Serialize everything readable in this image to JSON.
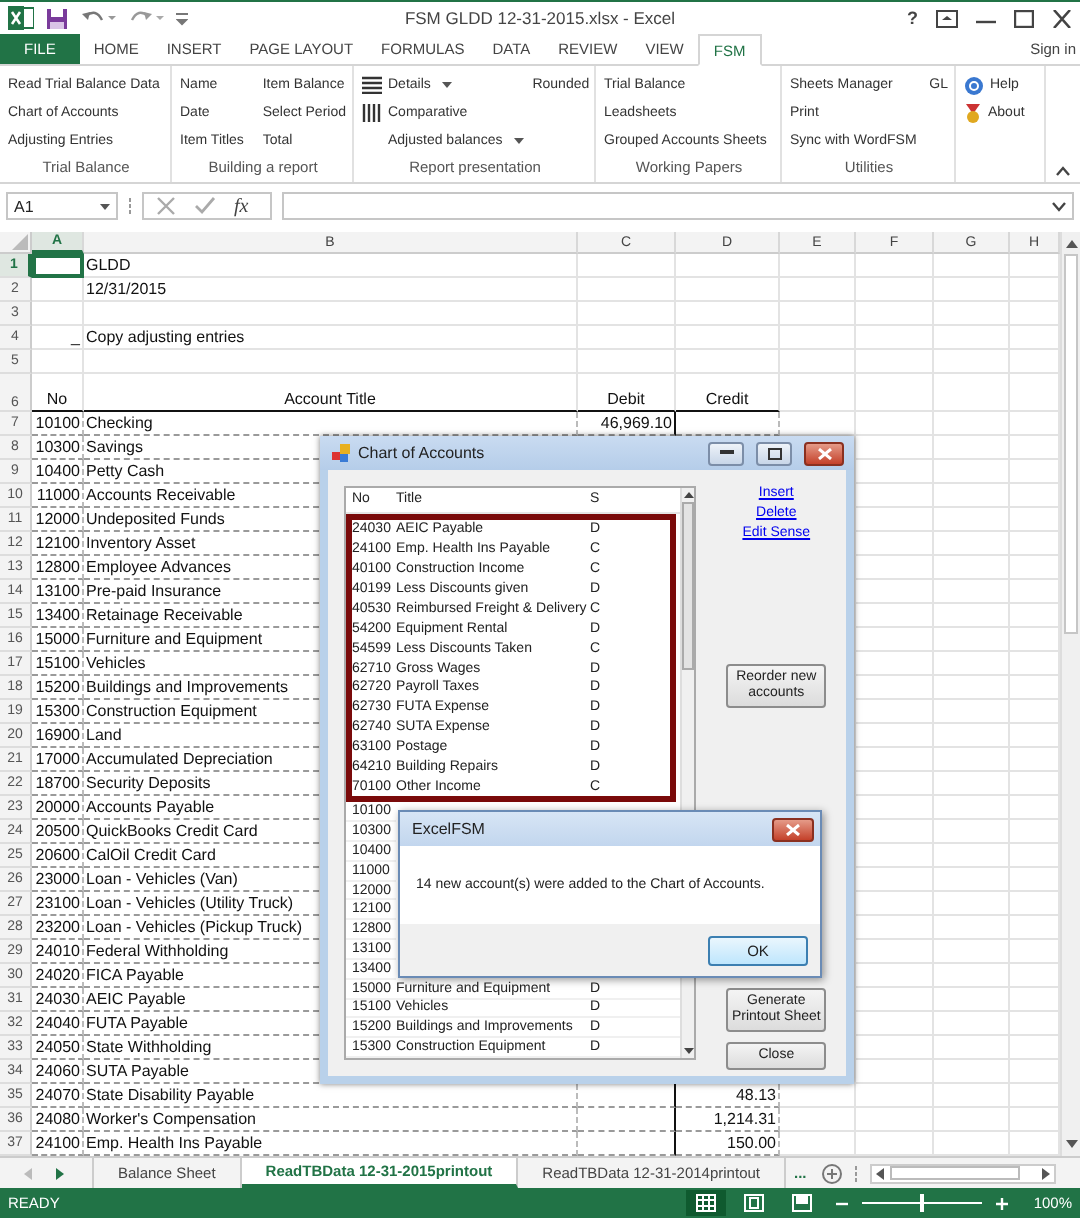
{
  "window": {
    "title": "FSM GLDD 12-31-2015.xlsx - Excel",
    "help_button": "?"
  },
  "ribbon_tabs": [
    {
      "label": "FILE",
      "kind": "file",
      "selected": false
    },
    {
      "label": "HOME",
      "kind": "tab",
      "selected": false
    },
    {
      "label": "INSERT",
      "kind": "tab",
      "selected": false
    },
    {
      "label": "PAGE LAYOUT",
      "kind": "tab",
      "selected": false
    },
    {
      "label": "FORMULAS",
      "kind": "tab",
      "selected": false
    },
    {
      "label": "DATA",
      "kind": "tab",
      "selected": false
    },
    {
      "label": "REVIEW",
      "kind": "tab",
      "selected": false
    },
    {
      "label": "VIEW",
      "kind": "tab",
      "selected": false
    },
    {
      "label": "FSM",
      "kind": "tab",
      "selected": true
    }
  ],
  "sign_in": "Sign in",
  "ribbon_groups": [
    {
      "label": "Trial Balance",
      "columns": [
        [
          {
            "label": "Read Trial Balance Data"
          },
          {
            "label": "Chart of Accounts"
          },
          {
            "label": "Adjusting Entries"
          }
        ]
      ]
    },
    {
      "label": "Building a report",
      "columns": [
        [
          {
            "label": "Name"
          },
          {
            "label": "Date"
          },
          {
            "label": "Item Titles"
          }
        ],
        [
          {
            "label": "Item Balance"
          },
          {
            "label": "Select Period"
          },
          {
            "label": "Total"
          }
        ]
      ]
    },
    {
      "label": "Report presentation",
      "columns": [
        [
          {
            "label": "Details",
            "dropdown": true
          },
          {
            "label": "Comparative"
          },
          {
            "label": "Adjusted balances",
            "dropdown": true
          }
        ],
        [
          {
            "label": "Rounded"
          }
        ]
      ]
    },
    {
      "label": "Working Papers",
      "columns": [
        [
          {
            "label": "Trial Balance"
          },
          {
            "label": "Leadsheets"
          },
          {
            "label": "Grouped Accounts Sheets"
          }
        ]
      ]
    },
    {
      "label": "Utilities",
      "columns": [
        [
          {
            "label": "Sheets Manager"
          },
          {
            "label": "Print"
          },
          {
            "label": "Sync with WordFSM"
          }
        ],
        [
          {
            "label": "GL"
          }
        ]
      ]
    },
    {
      "columns": [
        [
          {
            "label": "Help"
          },
          {
            "label": "About"
          }
        ]
      ]
    }
  ],
  "formula_bar": {
    "name_box": "A1",
    "function_button": "fx"
  },
  "sheet": {
    "columns": [
      {
        "label": "A",
        "selected": true
      },
      {
        "label": "B",
        "selected": false
      },
      {
        "label": "C",
        "selected": false
      },
      {
        "label": "D",
        "selected": false
      },
      {
        "label": "E",
        "selected": false
      },
      {
        "label": "F",
        "selected": false
      },
      {
        "label": "G",
        "selected": false
      },
      {
        "label": "H",
        "selected": false
      }
    ],
    "rows": [
      {
        "num": "1",
        "kind": "plain",
        "selected": true,
        "b": "GLDD"
      },
      {
        "num": "2",
        "kind": "plain",
        "selected": false,
        "b": "12/31/2015"
      },
      {
        "num": "3",
        "kind": "plain",
        "selected": false
      },
      {
        "num": "4",
        "kind": "plain",
        "selected": false,
        "a": "_",
        "b": "Copy adjusting entries"
      },
      {
        "num": "5",
        "kind": "plain",
        "selected": false
      },
      {
        "num": "6",
        "kind": "header",
        "selected": false,
        "a": "No",
        "b": "Account Title",
        "c": "Debit",
        "d": "Credit"
      },
      {
        "num": "7",
        "kind": "account",
        "selected": false,
        "a": "10100",
        "b": "Checking",
        "c": "46,969.10"
      },
      {
        "num": "8",
        "kind": "account",
        "selected": false,
        "a": "10300",
        "b": "Savings"
      },
      {
        "num": "9",
        "kind": "account",
        "selected": false,
        "a": "10400",
        "b": "Petty Cash"
      },
      {
        "num": "10",
        "kind": "account",
        "selected": false,
        "a": "11000",
        "b": "Accounts Receivable"
      },
      {
        "num": "11",
        "kind": "account",
        "selected": false,
        "a": "12000",
        "b": "Undeposited Funds"
      },
      {
        "num": "12",
        "kind": "account",
        "selected": false,
        "a": "12100",
        "b": "Inventory Asset"
      },
      {
        "num": "13",
        "kind": "account",
        "selected": false,
        "a": "12800",
        "b": "Employee Advances"
      },
      {
        "num": "14",
        "kind": "account",
        "selected": false,
        "a": "13100",
        "b": "Pre-paid Insurance"
      },
      {
        "num": "15",
        "kind": "account",
        "selected": false,
        "a": "13400",
        "b": "Retainage Receivable"
      },
      {
        "num": "16",
        "kind": "account",
        "selected": false,
        "a": "15000",
        "b": "Furniture and Equipment"
      },
      {
        "num": "17",
        "kind": "account",
        "selected": false,
        "a": "15100",
        "b": "Vehicles"
      },
      {
        "num": "18",
        "kind": "account",
        "selected": false,
        "a": "15200",
        "b": "Buildings and Improvements"
      },
      {
        "num": "19",
        "kind": "account",
        "selected": false,
        "a": "15300",
        "b": "Construction Equipment"
      },
      {
        "num": "20",
        "kind": "account",
        "selected": false,
        "a": "16900",
        "b": "Land"
      },
      {
        "num": "21",
        "kind": "account",
        "selected": false,
        "a": "17000",
        "b": "Accumulated Depreciation"
      },
      {
        "num": "22",
        "kind": "account",
        "selected": false,
        "a": "18700",
        "b": "Security Deposits"
      },
      {
        "num": "23",
        "kind": "account",
        "selected": false,
        "a": "20000",
        "b": "Accounts Payable"
      },
      {
        "num": "24",
        "kind": "account",
        "selected": false,
        "a": "20500",
        "b": "QuickBooks Credit Card"
      },
      {
        "num": "25",
        "kind": "account",
        "selected": false,
        "a": "20600",
        "b": "CalOil Credit Card"
      },
      {
        "num": "26",
        "kind": "account",
        "selected": false,
        "a": "23000",
        "b": "Loan - Vehicles (Van)"
      },
      {
        "num": "27",
        "kind": "account",
        "selected": false,
        "a": "23100",
        "b": "Loan - Vehicles (Utility Truck)"
      },
      {
        "num": "28",
        "kind": "account",
        "selected": false,
        "a": "23200",
        "b": "Loan - Vehicles (Pickup Truck)"
      },
      {
        "num": "29",
        "kind": "account",
        "selected": false,
        "a": "24010",
        "b": "Federal Withholding"
      },
      {
        "num": "30",
        "kind": "account",
        "selected": false,
        "a": "24020",
        "b": "FICA Payable"
      },
      {
        "num": "31",
        "kind": "account",
        "selected": false,
        "a": "24030",
        "b": "AEIC Payable"
      },
      {
        "num": "32",
        "kind": "account",
        "selected": false,
        "a": "24040",
        "b": "FUTA Payable"
      },
      {
        "num": "33",
        "kind": "account",
        "selected": false,
        "a": "24050",
        "b": "State Withholding"
      },
      {
        "num": "34",
        "kind": "account",
        "selected": false,
        "a": "24060",
        "b": "SUTA Payable"
      },
      {
        "num": "35",
        "kind": "account",
        "selected": false,
        "a": "24070",
        "b": "State Disability Payable",
        "d": "48.13"
      },
      {
        "num": "36",
        "kind": "account",
        "selected": false,
        "a": "24080",
        "b": "Worker's Compensation",
        "d": "1,214.31"
      },
      {
        "num": "37",
        "kind": "account",
        "selected": false,
        "a": "24100",
        "b": "Emp. Health Ins Payable",
        "d": "150.00"
      }
    ]
  },
  "sheet_tabs": {
    "tabs": [
      {
        "label": "Balance Sheet",
        "selected": false
      },
      {
        "label": "ReadTBData 12-31-2015printout",
        "selected": true
      },
      {
        "label": "ReadTBData 12-31-2014printout",
        "selected": false
      }
    ],
    "more": "..."
  },
  "status_bar": {
    "status": "READY",
    "zoom": {
      "level": 0.5,
      "reading": "100%"
    }
  },
  "chart_of_accounts": {
    "title": "Chart of Accounts",
    "columns": [
      "No",
      "Title",
      "S"
    ],
    "rows": [
      {
        "no": "24030",
        "title": "AEIC Payable",
        "s": "D",
        "highlighted": true
      },
      {
        "no": "24100",
        "title": "Emp. Health Ins Payable",
        "s": "C",
        "highlighted": true
      },
      {
        "no": "40100",
        "title": "Construction Income",
        "s": "C",
        "highlighted": true
      },
      {
        "no": "40199",
        "title": "Less Discounts given",
        "s": "D",
        "highlighted": true
      },
      {
        "no": "40530",
        "title": "Reimbursed Freight & Delivery",
        "s": "C",
        "highlighted": true
      },
      {
        "no": "54200",
        "title": "Equipment Rental",
        "s": "D",
        "highlighted": true
      },
      {
        "no": "54599",
        "title": "Less Discounts Taken",
        "s": "C",
        "highlighted": true
      },
      {
        "no": "62710",
        "title": "Gross Wages",
        "s": "D",
        "highlighted": true
      },
      {
        "no": "62720",
        "title": "Payroll Taxes",
        "s": "D",
        "highlighted": true
      },
      {
        "no": "62730",
        "title": "FUTA Expense",
        "s": "D",
        "highlighted": true
      },
      {
        "no": "62740",
        "title": "SUTA Expense",
        "s": "D",
        "highlighted": true
      },
      {
        "no": "63100",
        "title": "Postage",
        "s": "D",
        "highlighted": true
      },
      {
        "no": "64210",
        "title": "Building Repairs",
        "s": "D",
        "highlighted": true
      },
      {
        "no": "70100",
        "title": "Other Income",
        "s": "C",
        "highlighted": true
      },
      {
        "no": "10100",
        "highlighted": false
      },
      {
        "no": "10300",
        "highlighted": false
      },
      {
        "no": "10400",
        "highlighted": false
      },
      {
        "no": "11000",
        "highlighted": false
      },
      {
        "no": "12000",
        "highlighted": false
      },
      {
        "no": "12100",
        "highlighted": false
      },
      {
        "no": "12800",
        "highlighted": false
      },
      {
        "no": "13100",
        "highlighted": false
      },
      {
        "no": "13400",
        "highlighted": false
      },
      {
        "no": "15000",
        "title": "Furniture and Equipment",
        "s": "D",
        "highlighted": false
      },
      {
        "no": "15100",
        "title": "Vehicles",
        "s": "D",
        "highlighted": false
      },
      {
        "no": "15200",
        "title": "Buildings and Improvements",
        "s": "D",
        "highlighted": false
      },
      {
        "no": "15300",
        "title": "Construction Equipment",
        "s": "D",
        "highlighted": false
      }
    ],
    "links": [
      "Insert",
      "Delete",
      "Edit Sense"
    ],
    "buttons": [
      "Reorder new accounts",
      "Generate Printout Sheet",
      "Close"
    ]
  },
  "message_box": {
    "title": "ExcelFSM",
    "message": "14 new account(s) were added to the Chart of Accounts.",
    "button": "OK"
  }
}
